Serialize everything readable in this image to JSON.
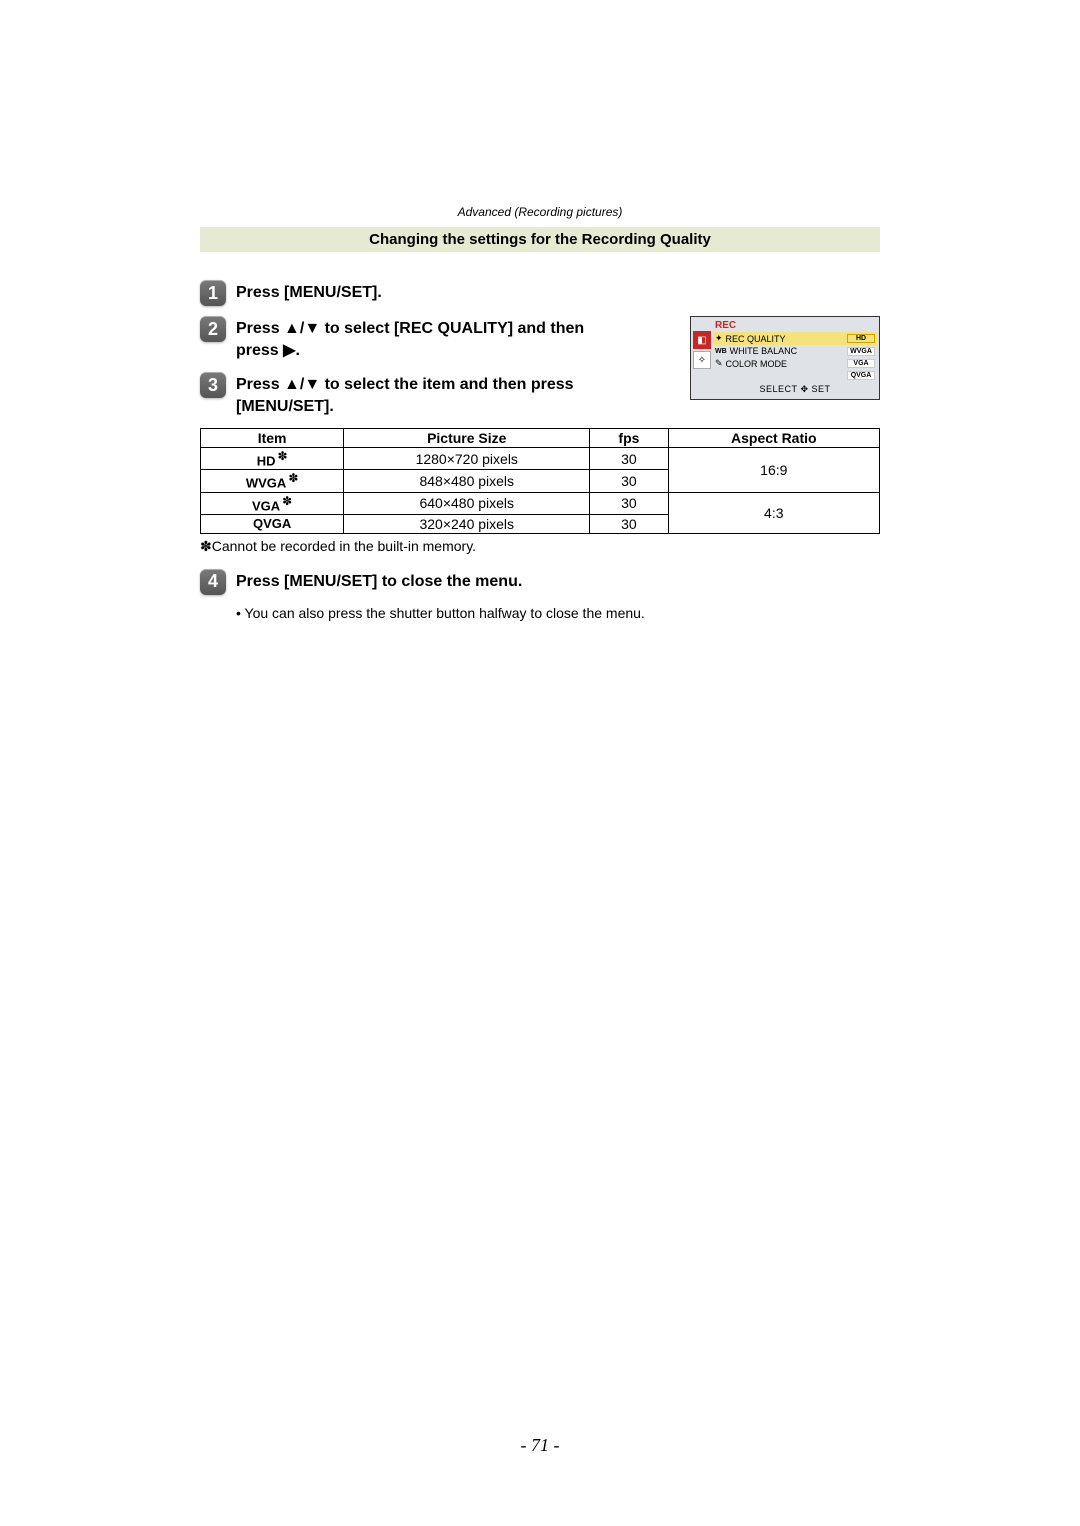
{
  "breadcrumb": "Advanced (Recording pictures)",
  "section_title": "Changing the settings for the Recording Quality",
  "steps": {
    "s1": {
      "num": "1",
      "text": "Press [MENU/SET]."
    },
    "s2": {
      "num": "2",
      "text": "Press ▲/▼ to select [REC QUALITY] and then press ▶."
    },
    "s3": {
      "num": "3",
      "text": "Press ▲/▼ to select the item and then press [MENU/SET]."
    },
    "s4": {
      "num": "4",
      "text": "Press [MENU/SET] to close the menu."
    }
  },
  "screenshot": {
    "header": "REC",
    "rows": [
      {
        "icon": "✦",
        "label": "REC QUALITY",
        "value": "HD",
        "highlight": true
      },
      {
        "icon": "WB",
        "label": "WHITE BALANC",
        "value": "WVGA",
        "highlight": false
      },
      {
        "icon": "✎",
        "label": "COLOR MODE",
        "value": "VGA",
        "highlight": false
      },
      {
        "icon": "",
        "label": "",
        "value": "QVGA",
        "highlight": false
      }
    ],
    "footer_select": "SELECT",
    "footer_set": "SET",
    "tab1_glyph": "◧",
    "tab2_glyph": "✧"
  },
  "table": {
    "headers": {
      "item": "Item",
      "size": "Picture Size",
      "fps": "fps",
      "aspect": "Aspect Ratio"
    },
    "rows": [
      {
        "item": "HD",
        "star": true,
        "size": "1280×720 pixels",
        "fps": "30"
      },
      {
        "item": "WVGA",
        "star": true,
        "size": "848×480 pixels",
        "fps": "30"
      },
      {
        "item": "VGA",
        "star": true,
        "size": "640×480 pixels",
        "fps": "30"
      },
      {
        "item": "QVGA",
        "star": false,
        "size": "320×240 pixels",
        "fps": "30"
      }
    ],
    "aspect_16_9": "16:9",
    "aspect_4_3": "4:3"
  },
  "footnote": "✽Cannot be recorded in the built-in memory.",
  "sub_bullet": "• You can also press the shutter button halfway to close the menu.",
  "star_glyph": "✽",
  "page_number": "- 71 -"
}
